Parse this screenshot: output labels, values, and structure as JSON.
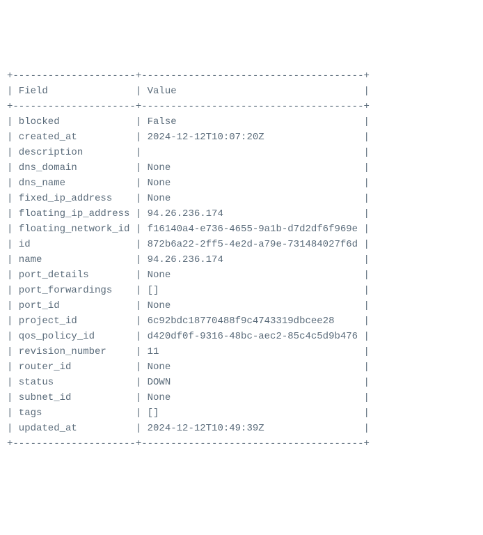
{
  "header": {
    "col1": "Field",
    "col2": "Value"
  },
  "rows": [
    {
      "field": "blocked",
      "value": "False"
    },
    {
      "field": "created_at",
      "value": "2024-12-12T10:07:20Z"
    },
    {
      "field": "description",
      "value": ""
    },
    {
      "field": "dns_domain",
      "value": "None"
    },
    {
      "field": "dns_name",
      "value": "None"
    },
    {
      "field": "fixed_ip_address",
      "value": "None"
    },
    {
      "field": "floating_ip_address",
      "value": "94.26.236.174"
    },
    {
      "field": "floating_network_id",
      "value": "f16140a4-e736-4655-9a1b-d7d2df6f969e"
    },
    {
      "field": "id",
      "value": "872b6a22-2ff5-4e2d-a79e-731484027f6d"
    },
    {
      "field": "name",
      "value": "94.26.236.174"
    },
    {
      "field": "port_details",
      "value": "None"
    },
    {
      "field": "port_forwardings",
      "value": "[]"
    },
    {
      "field": "port_id",
      "value": "None"
    },
    {
      "field": "project_id",
      "value": "6c92bdc18770488f9c4743319dbcee28"
    },
    {
      "field": "qos_policy_id",
      "value": "d420df0f-9316-48bc-aec2-85c4c5d9b476"
    },
    {
      "field": "revision_number",
      "value": "11"
    },
    {
      "field": "router_id",
      "value": "None"
    },
    {
      "field": "status",
      "value": "DOWN"
    },
    {
      "field": "subnet_id",
      "value": "None"
    },
    {
      "field": "tags",
      "value": "[]"
    },
    {
      "field": "updated_at",
      "value": "2024-12-12T10:49:39Z"
    }
  ],
  "col1_width": 21,
  "col2_width": 38
}
